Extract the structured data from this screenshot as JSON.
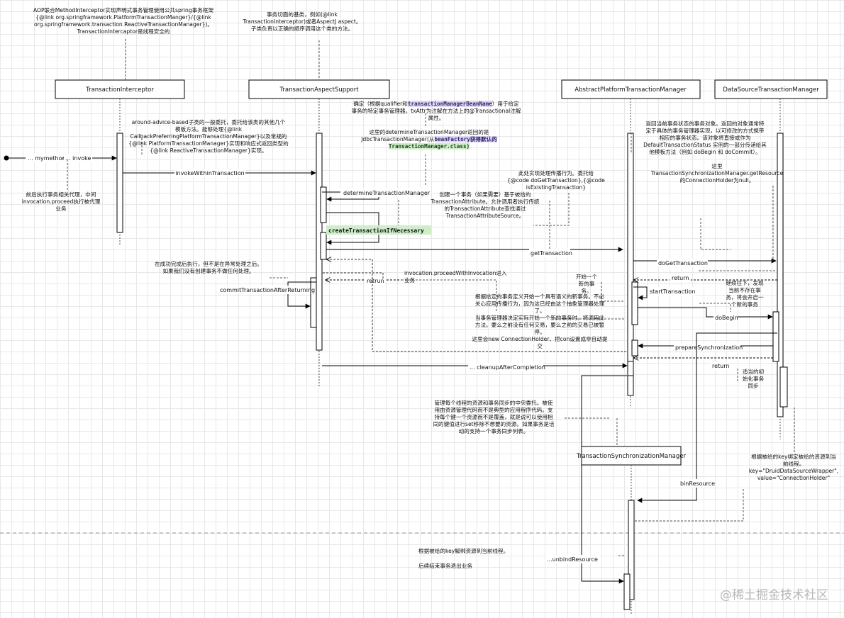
{
  "participants": [
    {
      "id": "p1",
      "label": "TransactionInterceptor"
    },
    {
      "id": "p2",
      "label": "TransactionAspectSupport"
    },
    {
      "id": "p3",
      "label": "AbstractPlatformTransactionManager"
    },
    {
      "id": "p4",
      "label": "DataSourceTransactionManager"
    },
    {
      "id": "p5",
      "label": "TransactionSynchronizationManager"
    }
  ],
  "messages": {
    "mymethod": "... mymethod",
    "invoke": "... invoke",
    "invokeWithinTransaction": "invokeWithinTransaction",
    "determineTransactionManager": "determineTransactionManager",
    "createTransactionIfNecessary": "createTransactionIfNecessary",
    "getTransaction": "getTransaction",
    "doGetTransaction": "doGetTransaction",
    "return1": "return",
    "startTransaction": "startTransaction",
    "doBegin": "doBegin",
    "prepareSynchronization": "prepareSynchronization",
    "return2": "return",
    "commitTransactionAfterReturning": "commitTransactionAfterReturning",
    "retrun": "retrun",
    "cleanupAfterCompletion": "... cleanupAfterCompletion",
    "binResource": "binResource",
    "unbindResource": "...unbindResource"
  },
  "notes": {
    "n_interceptor_top": [
      "AOP联合MethodInterceptor实现声明式事务管理使用公共spring事务框架",
      "{@link org.springframework.PlatformTransactionManger}/{@link",
      "org.springframework.transaction.ReactiveTransactionManager})。",
      "TransactionIntercaptor是线程安全的"
    ],
    "n_aspect_top": [
      "事务切面的基类，例如(@link",
      "TransactionInterceptor)或者AspectJ aspect。",
      "子类负责以正确的顺序调用这个类的方法。"
    ],
    "n_around": [
      "around-advice-based子类的一般委托，委托给该类的其他几个",
      "模板方法。能够处理{@link",
      "CallbackPreferringPlatformTransactionManager}以及常规的",
      "{@link PlatformTransactionManager}实现和响应式返回类型的",
      "{@link ReactiveTransactionManager}实现。"
    ],
    "n_proceed_left": [
      "前后执行事务相关代理，中间",
      "invocation.proceed执行被代理",
      "业务"
    ],
    "n_qualifier_pre": "确定（根据qualifier和",
    "n_qualifier_code": "transactionManagerBeanName",
    "n_qualifier_post": "）用于给定",
    "n_qualifier_rest": [
      "事务的特定事务管理器。txAttr为注解在方法上的@Transactional注解",
      "属性。"
    ],
    "n_jdbc_1": "这里的determineTransactionManager返回的是",
    "n_jdbc_2a": "JdbcTransactionManager(从",
    "n_jdbc_2b": "beanFactory获得默认的",
    "n_jdbc_3": "TransactionManager.class)",
    "n_propagation": [
      "此处实现处理传播行为。委托给",
      "{@code doGetTransaction},{@code",
      "isExistingTransaction}"
    ],
    "n_create": [
      "创建一个事务（如果需要）基于被给的",
      "TransactionAttribute。允许调用者执行传统",
      "的TransactionAttribute查找通过",
      "TransactionAttributeSource。"
    ],
    "n_return_state": [
      "返回当前事务状态的事务对象。返回的对象通常特",
      "定于具体的事务管理器实现，以可修改的方式携带",
      "相应的事务状态。该对象将直接或作为",
      "DefaultTransactionStatus 实例的一部分传递给其",
      "他模板方法（例如 doBegin 和 doCommit）。"
    ],
    "n_holder": [
      "这里",
      "TransactionSynchronizationManager.getResource",
      "的ConnectionHolder为null。"
    ],
    "n_after_success": [
      "在成功完成后执行，但不是在异常处理之后。",
      "如果我们没有创建事务不做任何处理。"
    ],
    "n_proceed_mid": [
      "invocation.proceedWithInvocation进入",
      "业务"
    ],
    "n_start": [
      "开始一个",
      "新的事",
      "务。"
    ],
    "n_continue": [
      "继续往下，发现",
      "当前不存在事",
      "务，将会开启一",
      "个新的事务"
    ],
    "n_semantic": [
      "根据给定的事务定义开始一个具有语义的新事务。不必",
      "关心应用传播行为，因为这已经由这个抽象管理器处理",
      "了。",
      "当事务管理器决定实际开始一个新的事务时，将调用此",
      "方法。要么之前没有任何交易，要么之前的交易已被暂",
      "停。",
      "这里会new ConnectionHolder、把con设置成非自动提",
      "交"
    ],
    "n_init_sync": [
      "适当的初",
      "始化事务",
      "同步"
    ],
    "n_central": [
      "管理每个线程的资源和事务同步的中央委托。被使",
      "用由资源管理代码而不是典型的应用程序代码。支",
      "持每个键一个资源而不是覆盖，就是说可以使用相",
      "同的键值进行set移除不想要的资源。如果事务是活",
      "动的支持一个事务同步列表。"
    ],
    "n_bind": [
      "根据被给的key绑定被给的资源到当",
      "前线程。",
      "key=\"DruidDataSourceWrapper\",",
      "value=\"ConnectionHolder\""
    ],
    "n_unbind": "根据被给的key解绑资源到当前线程。",
    "n_finish": "后续结束事务退出业务"
  },
  "watermark": "@稀土掘金技术社区"
}
